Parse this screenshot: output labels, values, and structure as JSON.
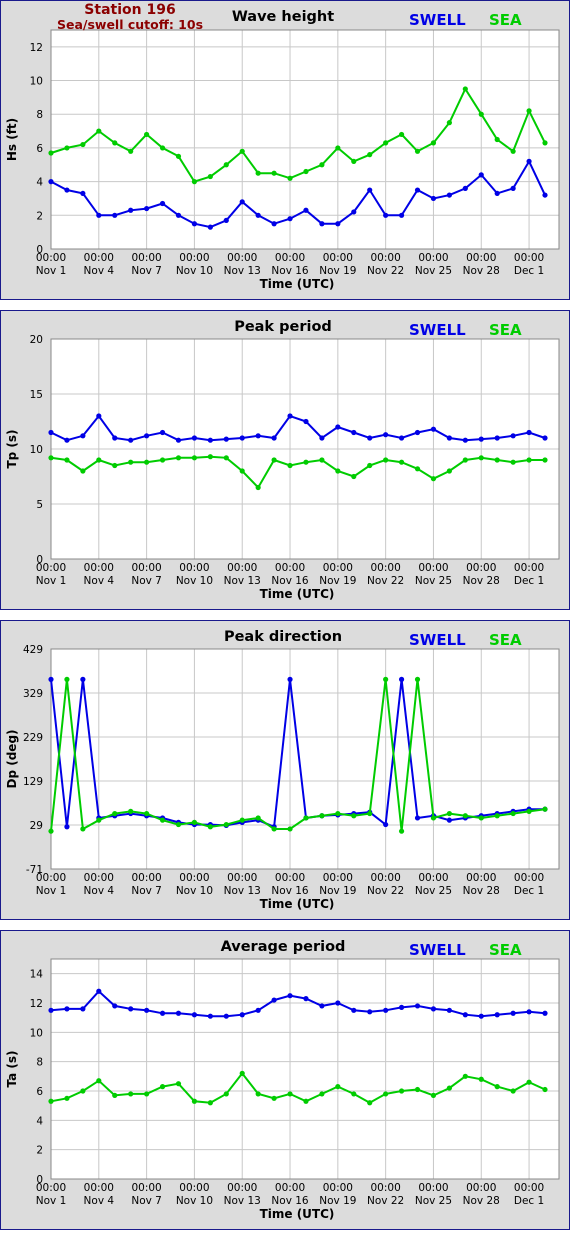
{
  "station": {
    "title": "Station 196",
    "subtitle": "Sea/swell cutoff: 10s"
  },
  "colors": {
    "swell": "#0000e6",
    "sea": "#00cc00",
    "frame": "#1a1a8c",
    "panel_bg": "#dcdcdc",
    "grid": "#c8c8c8"
  },
  "legend": {
    "swell": "SWELL",
    "sea": "SEA"
  },
  "x_axis": {
    "label": "Time (UTC)",
    "ticks": [
      {
        "time": "00:00",
        "date": "Nov 1"
      },
      {
        "time": "00:00",
        "date": "Nov 4"
      },
      {
        "time": "00:00",
        "date": "Nov 7"
      },
      {
        "time": "00:00",
        "date": "Nov 10"
      },
      {
        "time": "00:00",
        "date": "Nov 13"
      },
      {
        "time": "00:00",
        "date": "Nov 16"
      },
      {
        "time": "00:00",
        "date": "Nov 19"
      },
      {
        "time": "00:00",
        "date": "Nov 22"
      },
      {
        "time": "00:00",
        "date": "Nov 25"
      },
      {
        "time": "00:00",
        "date": "Nov 28"
      },
      {
        "time": "00:00",
        "date": "Dec 1"
      }
    ]
  },
  "chart_data": [
    {
      "type": "line",
      "title": "Wave height",
      "ylabel": "Hs (ft)",
      "ylim": [
        0,
        13
      ],
      "yticks": [
        "0",
        "2",
        "4",
        "6",
        "8",
        "10",
        "12"
      ],
      "x": [
        "Nov 1",
        "Nov 2",
        "Nov 3",
        "Nov 4",
        "Nov 5",
        "Nov 6",
        "Nov 7",
        "Nov 8",
        "Nov 9",
        "Nov 10",
        "Nov 11",
        "Nov 12",
        "Nov 13",
        "Nov 14",
        "Nov 15",
        "Nov 16",
        "Nov 17",
        "Nov 18",
        "Nov 19",
        "Nov 20",
        "Nov 21",
        "Nov 22",
        "Nov 23",
        "Nov 24",
        "Nov 25",
        "Nov 26",
        "Nov 27",
        "Nov 28",
        "Nov 29",
        "Nov 30",
        "Dec 1",
        "Dec 2"
      ],
      "series": [
        {
          "name": "SWELL",
          "values": [
            4.0,
            3.5,
            3.3,
            2.0,
            2.0,
            2.3,
            2.4,
            2.7,
            2.0,
            1.5,
            1.3,
            1.7,
            2.8,
            2.0,
            1.5,
            1.8,
            2.3,
            1.5,
            1.5,
            2.2,
            3.5,
            2.0,
            2.0,
            3.5,
            3.0,
            3.2,
            3.6,
            4.4,
            3.3,
            3.6,
            5.2,
            3.2
          ]
        },
        {
          "name": "SEA",
          "values": [
            5.7,
            6.0,
            6.2,
            7.0,
            6.3,
            5.8,
            6.8,
            6.0,
            5.5,
            4.0,
            4.3,
            5.0,
            5.8,
            4.5,
            4.5,
            4.2,
            4.6,
            5.0,
            6.0,
            5.2,
            5.6,
            6.3,
            6.8,
            5.8,
            6.3,
            7.5,
            9.5,
            8.0,
            6.5,
            5.8,
            8.2,
            6.3
          ]
        }
      ]
    },
    {
      "type": "line",
      "title": "Peak period",
      "ylabel": "Tp (s)",
      "ylim": [
        0,
        20
      ],
      "yticks": [
        "0",
        "5",
        "10",
        "15",
        "20"
      ],
      "x": [
        "Nov 1",
        "Nov 2",
        "Nov 3",
        "Nov 4",
        "Nov 5",
        "Nov 6",
        "Nov 7",
        "Nov 8",
        "Nov 9",
        "Nov 10",
        "Nov 11",
        "Nov 12",
        "Nov 13",
        "Nov 14",
        "Nov 15",
        "Nov 16",
        "Nov 17",
        "Nov 18",
        "Nov 19",
        "Nov 20",
        "Nov 21",
        "Nov 22",
        "Nov 23",
        "Nov 24",
        "Nov 25",
        "Nov 26",
        "Nov 27",
        "Nov 28",
        "Nov 29",
        "Nov 30",
        "Dec 1",
        "Dec 2"
      ],
      "series": [
        {
          "name": "SWELL",
          "values": [
            11.5,
            10.8,
            11.2,
            13.0,
            11.0,
            10.8,
            11.2,
            11.5,
            10.8,
            11.0,
            10.8,
            10.9,
            11.0,
            11.2,
            11.0,
            13.0,
            12.5,
            11.0,
            12.0,
            11.5,
            11.0,
            11.3,
            11.0,
            11.5,
            11.8,
            11.0,
            10.8,
            10.9,
            11.0,
            11.2,
            11.5,
            11.0
          ]
        },
        {
          "name": "SEA",
          "values": [
            9.2,
            9.0,
            8.0,
            9.0,
            8.5,
            8.8,
            8.8,
            9.0,
            9.2,
            9.2,
            9.3,
            9.2,
            8.0,
            6.5,
            9.0,
            8.5,
            8.8,
            9.0,
            8.0,
            7.5,
            8.5,
            9.0,
            8.8,
            8.2,
            7.3,
            8.0,
            9.0,
            9.2,
            9.0,
            8.8,
            9.0,
            9.0
          ]
        }
      ]
    },
    {
      "type": "line",
      "title": "Peak direction",
      "ylabel": "Dp (deg)",
      "ylim": [
        -71,
        429
      ],
      "yticks": [
        "-71",
        "29",
        "129",
        "229",
        "329",
        "429"
      ],
      "x": [
        "Nov 1",
        "Nov 2",
        "Nov 3",
        "Nov 4",
        "Nov 5",
        "Nov 6",
        "Nov 7",
        "Nov 8",
        "Nov 9",
        "Nov 10",
        "Nov 11",
        "Nov 12",
        "Nov 13",
        "Nov 14",
        "Nov 15",
        "Nov 16",
        "Nov 17",
        "Nov 18",
        "Nov 19",
        "Nov 20",
        "Nov 21",
        "Nov 22",
        "Nov 23",
        "Nov 24",
        "Nov 25",
        "Nov 26",
        "Nov 27",
        "Nov 28",
        "Nov 29",
        "Nov 30",
        "Dec 1",
        "Dec 2"
      ],
      "series": [
        {
          "name": "SWELL",
          "values": [
            360,
            25,
            360,
            45,
            50,
            55,
            50,
            45,
            35,
            30,
            30,
            28,
            35,
            40,
            25,
            360,
            45,
            50,
            52,
            55,
            58,
            30,
            360,
            45,
            50,
            40,
            45,
            50,
            55,
            60,
            65,
            65
          ]
        },
        {
          "name": "SEA",
          "values": [
            15,
            360,
            20,
            40,
            55,
            60,
            55,
            40,
            30,
            35,
            25,
            30,
            40,
            45,
            20,
            20,
            45,
            50,
            55,
            50,
            55,
            360,
            15,
            360,
            45,
            55,
            50,
            45,
            50,
            55,
            60,
            65
          ]
        }
      ]
    },
    {
      "type": "line",
      "title": "Average period",
      "ylabel": "Ta (s)",
      "ylim": [
        0,
        15
      ],
      "yticks": [
        "0",
        "2",
        "4",
        "6",
        "8",
        "10",
        "12",
        "14"
      ],
      "x": [
        "Nov 1",
        "Nov 2",
        "Nov 3",
        "Nov 4",
        "Nov 5",
        "Nov 6",
        "Nov 7",
        "Nov 8",
        "Nov 9",
        "Nov 10",
        "Nov 11",
        "Nov 12",
        "Nov 13",
        "Nov 14",
        "Nov 15",
        "Nov 16",
        "Nov 17",
        "Nov 18",
        "Nov 19",
        "Nov 20",
        "Nov 21",
        "Nov 22",
        "Nov 23",
        "Nov 24",
        "Nov 25",
        "Nov 26",
        "Nov 27",
        "Nov 28",
        "Nov 29",
        "Nov 30",
        "Dec 1",
        "Dec 2"
      ],
      "series": [
        {
          "name": "SWELL",
          "values": [
            11.5,
            11.6,
            11.6,
            12.8,
            11.8,
            11.6,
            11.5,
            11.3,
            11.3,
            11.2,
            11.1,
            11.1,
            11.2,
            11.5,
            12.2,
            12.5,
            12.3,
            11.8,
            12.0,
            11.5,
            11.4,
            11.5,
            11.7,
            11.8,
            11.6,
            11.5,
            11.2,
            11.1,
            11.2,
            11.3,
            11.4,
            11.3
          ]
        },
        {
          "name": "SEA",
          "values": [
            5.3,
            5.5,
            6.0,
            6.7,
            5.7,
            5.8,
            5.8,
            6.3,
            6.5,
            5.3,
            5.2,
            5.8,
            7.2,
            5.8,
            5.5,
            5.8,
            5.3,
            5.8,
            6.3,
            5.8,
            5.2,
            5.8,
            6.0,
            6.1,
            5.7,
            6.2,
            7.0,
            6.8,
            6.3,
            6.0,
            6.6,
            6.1
          ]
        }
      ]
    }
  ]
}
